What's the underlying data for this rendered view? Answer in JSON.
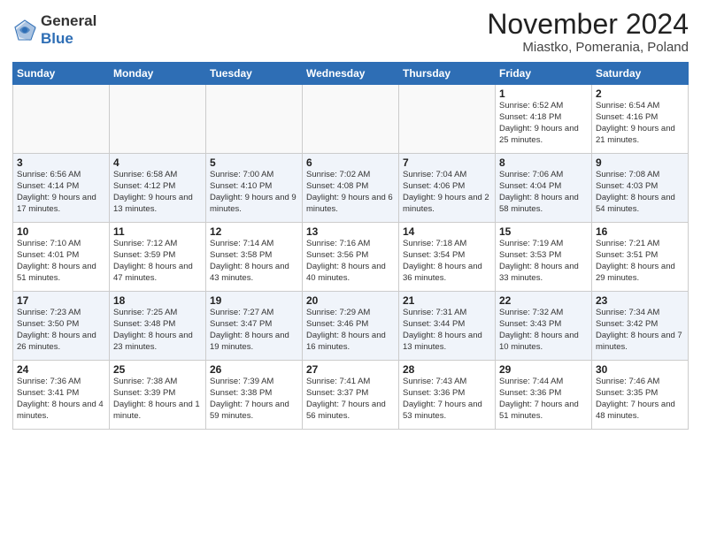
{
  "header": {
    "logo_line1": "General",
    "logo_line2": "Blue",
    "month_title": "November 2024",
    "subtitle": "Miastko, Pomerania, Poland"
  },
  "days_of_week": [
    "Sunday",
    "Monday",
    "Tuesday",
    "Wednesday",
    "Thursday",
    "Friday",
    "Saturday"
  ],
  "weeks": [
    [
      {
        "day": "",
        "info": ""
      },
      {
        "day": "",
        "info": ""
      },
      {
        "day": "",
        "info": ""
      },
      {
        "day": "",
        "info": ""
      },
      {
        "day": "",
        "info": ""
      },
      {
        "day": "1",
        "info": "Sunrise: 6:52 AM\nSunset: 4:18 PM\nDaylight: 9 hours\nand 25 minutes."
      },
      {
        "day": "2",
        "info": "Sunrise: 6:54 AM\nSunset: 4:16 PM\nDaylight: 9 hours\nand 21 minutes."
      }
    ],
    [
      {
        "day": "3",
        "info": "Sunrise: 6:56 AM\nSunset: 4:14 PM\nDaylight: 9 hours\nand 17 minutes."
      },
      {
        "day": "4",
        "info": "Sunrise: 6:58 AM\nSunset: 4:12 PM\nDaylight: 9 hours\nand 13 minutes."
      },
      {
        "day": "5",
        "info": "Sunrise: 7:00 AM\nSunset: 4:10 PM\nDaylight: 9 hours\nand 9 minutes."
      },
      {
        "day": "6",
        "info": "Sunrise: 7:02 AM\nSunset: 4:08 PM\nDaylight: 9 hours\nand 6 minutes."
      },
      {
        "day": "7",
        "info": "Sunrise: 7:04 AM\nSunset: 4:06 PM\nDaylight: 9 hours\nand 2 minutes."
      },
      {
        "day": "8",
        "info": "Sunrise: 7:06 AM\nSunset: 4:04 PM\nDaylight: 8 hours\nand 58 minutes."
      },
      {
        "day": "9",
        "info": "Sunrise: 7:08 AM\nSunset: 4:03 PM\nDaylight: 8 hours\nand 54 minutes."
      }
    ],
    [
      {
        "day": "10",
        "info": "Sunrise: 7:10 AM\nSunset: 4:01 PM\nDaylight: 8 hours\nand 51 minutes."
      },
      {
        "day": "11",
        "info": "Sunrise: 7:12 AM\nSunset: 3:59 PM\nDaylight: 8 hours\nand 47 minutes."
      },
      {
        "day": "12",
        "info": "Sunrise: 7:14 AM\nSunset: 3:58 PM\nDaylight: 8 hours\nand 43 minutes."
      },
      {
        "day": "13",
        "info": "Sunrise: 7:16 AM\nSunset: 3:56 PM\nDaylight: 8 hours\nand 40 minutes."
      },
      {
        "day": "14",
        "info": "Sunrise: 7:18 AM\nSunset: 3:54 PM\nDaylight: 8 hours\nand 36 minutes."
      },
      {
        "day": "15",
        "info": "Sunrise: 7:19 AM\nSunset: 3:53 PM\nDaylight: 8 hours\nand 33 minutes."
      },
      {
        "day": "16",
        "info": "Sunrise: 7:21 AM\nSunset: 3:51 PM\nDaylight: 8 hours\nand 29 minutes."
      }
    ],
    [
      {
        "day": "17",
        "info": "Sunrise: 7:23 AM\nSunset: 3:50 PM\nDaylight: 8 hours\nand 26 minutes."
      },
      {
        "day": "18",
        "info": "Sunrise: 7:25 AM\nSunset: 3:48 PM\nDaylight: 8 hours\nand 23 minutes."
      },
      {
        "day": "19",
        "info": "Sunrise: 7:27 AM\nSunset: 3:47 PM\nDaylight: 8 hours\nand 19 minutes."
      },
      {
        "day": "20",
        "info": "Sunrise: 7:29 AM\nSunset: 3:46 PM\nDaylight: 8 hours\nand 16 minutes."
      },
      {
        "day": "21",
        "info": "Sunrise: 7:31 AM\nSunset: 3:44 PM\nDaylight: 8 hours\nand 13 minutes."
      },
      {
        "day": "22",
        "info": "Sunrise: 7:32 AM\nSunset: 3:43 PM\nDaylight: 8 hours\nand 10 minutes."
      },
      {
        "day": "23",
        "info": "Sunrise: 7:34 AM\nSunset: 3:42 PM\nDaylight: 8 hours\nand 7 minutes."
      }
    ],
    [
      {
        "day": "24",
        "info": "Sunrise: 7:36 AM\nSunset: 3:41 PM\nDaylight: 8 hours\nand 4 minutes."
      },
      {
        "day": "25",
        "info": "Sunrise: 7:38 AM\nSunset: 3:39 PM\nDaylight: 8 hours\nand 1 minute."
      },
      {
        "day": "26",
        "info": "Sunrise: 7:39 AM\nSunset: 3:38 PM\nDaylight: 7 hours\nand 59 minutes."
      },
      {
        "day": "27",
        "info": "Sunrise: 7:41 AM\nSunset: 3:37 PM\nDaylight: 7 hours\nand 56 minutes."
      },
      {
        "day": "28",
        "info": "Sunrise: 7:43 AM\nSunset: 3:36 PM\nDaylight: 7 hours\nand 53 minutes."
      },
      {
        "day": "29",
        "info": "Sunrise: 7:44 AM\nSunset: 3:36 PM\nDaylight: 7 hours\nand 51 minutes."
      },
      {
        "day": "30",
        "info": "Sunrise: 7:46 AM\nSunset: 3:35 PM\nDaylight: 7 hours\nand 48 minutes."
      }
    ]
  ]
}
